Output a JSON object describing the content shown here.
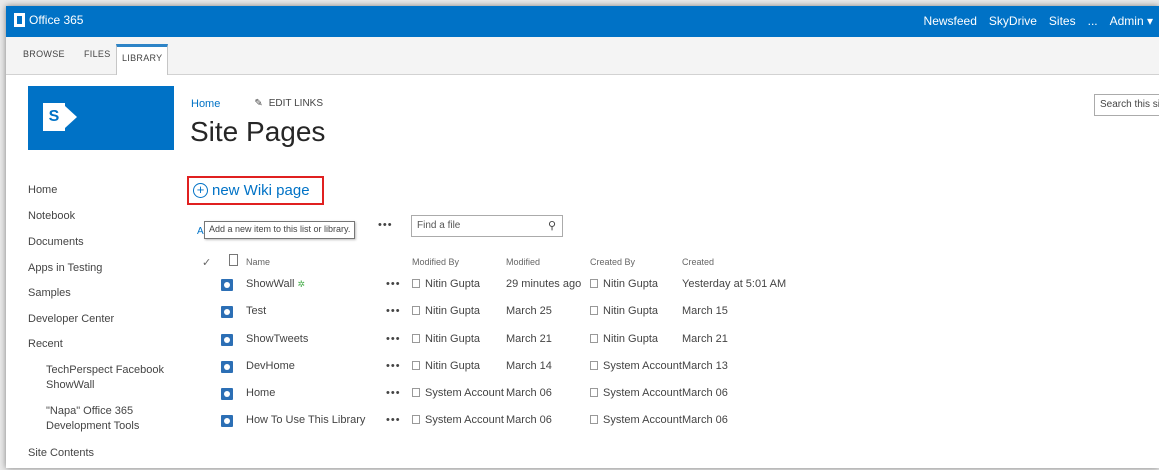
{
  "suite_bar": {
    "brand": "Office 365",
    "nav": [
      "Newsfeed",
      "SkyDrive",
      "Sites",
      "...",
      "Admin ▾"
    ]
  },
  "ribbon": {
    "tabs": [
      "BROWSE",
      "FILES",
      "LIBRARY"
    ]
  },
  "breadcrumb": {
    "home": "Home",
    "edit_links": "EDIT LINKS"
  },
  "page_title": "Site Pages",
  "search": {
    "placeholder": "Search this site"
  },
  "quick_launch": {
    "items": [
      "Home",
      "Notebook",
      "Documents",
      "Apps in Testing",
      "Samples",
      "Developer Center",
      "Recent"
    ],
    "recent": [
      "TechPerspect Facebook ShowWall",
      "\"Napa\" Office 365 Development Tools"
    ],
    "site_contents": "Site Contents"
  },
  "new_wiki": {
    "label": "new Wiki page",
    "icon": "plus-circle-icon"
  },
  "toolbar": {
    "all_link": "All",
    "tooltip": "Add a new item to this list or library.",
    "more": "•••",
    "find_placeholder": "Find a file"
  },
  "table": {
    "columns": [
      "Name",
      "Modified By",
      "Modified",
      "Created By",
      "Created"
    ],
    "rows": [
      {
        "name": "ShowWall",
        "is_new": true,
        "modified_by": "Nitin Gupta",
        "modified": "29 minutes ago",
        "created_by": "Nitin Gupta",
        "created": "Yesterday at 5:01 AM"
      },
      {
        "name": "Test",
        "is_new": false,
        "modified_by": "Nitin Gupta",
        "modified": "March 25",
        "created_by": "Nitin Gupta",
        "created": "March 15"
      },
      {
        "name": "ShowTweets",
        "is_new": false,
        "modified_by": "Nitin Gupta",
        "modified": "March 21",
        "created_by": "Nitin Gupta",
        "created": "March 21"
      },
      {
        "name": "DevHome",
        "is_new": false,
        "modified_by": "Nitin Gupta",
        "modified": "March 14",
        "created_by": "System Account",
        "created": "March 13"
      },
      {
        "name": "Home",
        "is_new": false,
        "modified_by": "System Account",
        "modified": "March 06",
        "created_by": "System Account",
        "created": "March 06"
      },
      {
        "name": "How To Use This Library",
        "is_new": false,
        "modified_by": "System Account",
        "modified": "March 06",
        "created_by": "System Account",
        "created": "March 06"
      }
    ],
    "row_more": "•••",
    "new_badge": "✲"
  },
  "colors": {
    "suite_bar": "#0072c6",
    "accent": "#0072c6",
    "highlight_box": "#e02020"
  }
}
